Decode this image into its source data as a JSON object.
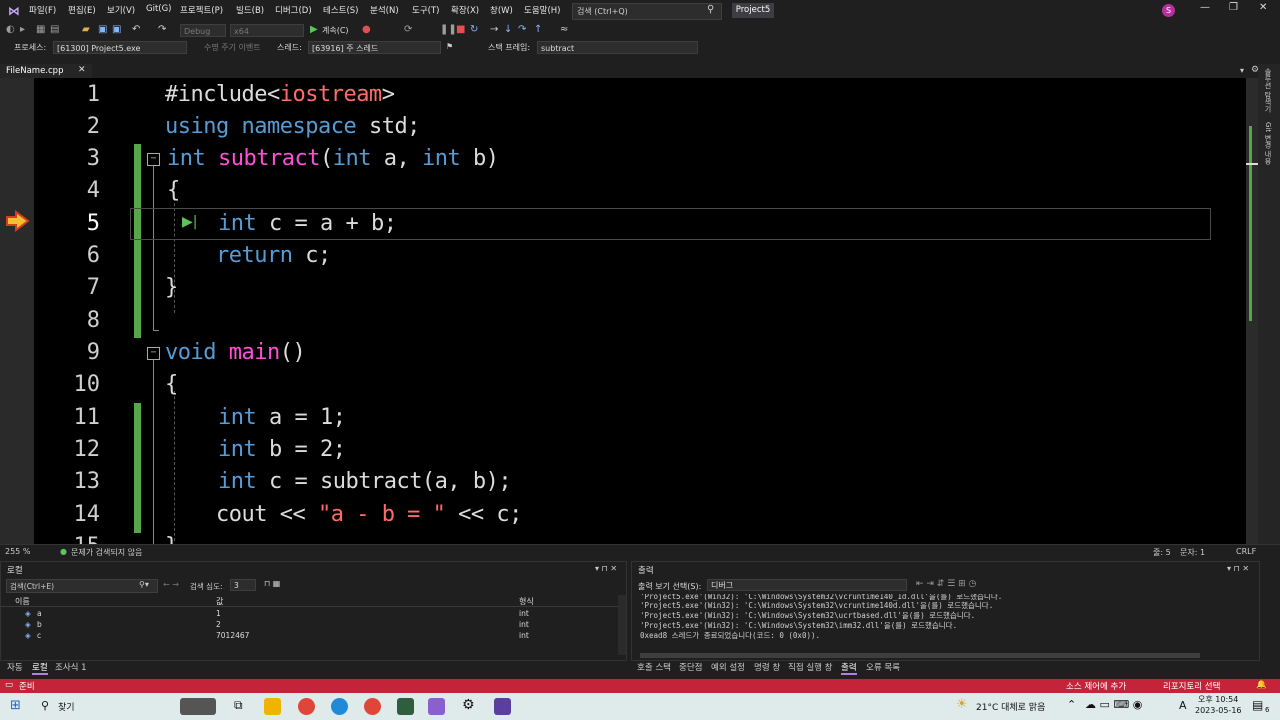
{
  "menu": {
    "items": [
      "파일(F)",
      "편집(E)",
      "보기(V)",
      "Git(G)",
      "프로젝트(P)",
      "빌드(B)",
      "디버그(D)",
      "테스트(S)",
      "분석(N)",
      "도구(T)",
      "확장(X)",
      "창(W)",
      "도움말(H)"
    ],
    "search_placeholder": "검색 (Ctrl+Q)",
    "solution_name": "Project5",
    "avatar_letter": "S"
  },
  "toolbar": {
    "config": "Debug",
    "platform": "x64",
    "continue_label": "계속(C)"
  },
  "debugbar": {
    "process_label": "프로세스:",
    "process_value": "[61300] Project5.exe",
    "lifecycle_label": "수명 주기 이벤트",
    "thread_label": "스레드:",
    "thread_value": "[63916] 주 스레드",
    "stackframe_label": "스택 프레임:",
    "stackframe_value": "subtract"
  },
  "editor": {
    "tab_title": "FileName.cpp",
    "current_line": 5,
    "line_numbers": [
      "1",
      "2",
      "3",
      "4",
      "5",
      "6",
      "7",
      "8",
      "9",
      "10",
      "11",
      "12",
      "13",
      "14",
      "15"
    ],
    "zoom": "255 %",
    "issues": "문제가 검색되지 않음",
    "position_line": "줄: 5",
    "position_char": "문자: 1",
    "line_ending": "CRLF",
    "right_panel_labels": [
      "솔루션 탐색기",
      "Git 변경 내용"
    ]
  },
  "code_tokens": {
    "l1_a": "#include<",
    "l1_b": "iostream",
    "l1_c": ">",
    "using": "using",
    "namespace": "namespace",
    "std": " std;",
    "int": "int",
    "subtract": "subtract",
    "paren_open": "(",
    "a_comma": " a, ",
    "b_close": " b)",
    "brace_open": "{",
    "brace_close": "}",
    "c_eq_ab": " c = a + b;",
    "return_kw": "return",
    "c_semi": " c;",
    "void": "void",
    "main": "main",
    "main_parens": "()",
    "a_eq_1": " a = 1;",
    "b_eq_2": " b = 2;",
    "c_eq_sub": " c = subtract(a, b);",
    "cout": "cout << ",
    "str": "\"a - b = \"",
    "cout_end": " << c;"
  },
  "locals": {
    "title": "로컬",
    "search_placeholder": "검색(Ctrl+E)",
    "search_depth_label": "검색 심도:",
    "search_depth": "3",
    "headers": [
      "이름",
      "값",
      "형식"
    ],
    "rows": [
      {
        "name": "a",
        "value": "1",
        "type": "int"
      },
      {
        "name": "b",
        "value": "2",
        "type": "int"
      },
      {
        "name": "c",
        "value": "7012467",
        "type": "int"
      }
    ],
    "tabs": [
      "자동",
      "로컬",
      "조사식 1"
    ]
  },
  "output": {
    "title": "출력",
    "show_label": "출력 보기 선택(S):",
    "show_value": "디버그",
    "lines": [
      "'Project5.exe'(Win32): 'C:\\Windows\\System32\\vcruntime140_1d.dll'을(를) 로드했습니다.",
      "'Project5.exe'(Win32): 'C:\\Windows\\System32\\vcruntime140d.dll'을(를) 로드했습니다.",
      "'Project5.exe'(Win32): 'C:\\Windows\\System32\\ucrtbased.dll'을(를) 로드했습니다.",
      "'Project5.exe'(Win32): 'C:\\Windows\\System32\\imm32.dll'을(를) 로드했습니다.",
      "0xead8 스레드가 종료되었습니다(코드: 0 (0x0))."
    ],
    "tabs": [
      "호출 스택",
      "중단점",
      "예외 설정",
      "명령 창",
      "직접 실행 창",
      "출력",
      "오류 목록"
    ]
  },
  "status": {
    "ready": "준비",
    "source_control": "소스 제어에 추가",
    "repo": "리포지토리 선택"
  },
  "taskbar": {
    "search": "찾기",
    "weather": "21°C  대체로 맑음",
    "ampm_time": "오후 10:54",
    "date": "2023-05-16",
    "lang": "A",
    "notif_count": "6"
  },
  "colors": {
    "keyword": "#569cd6",
    "function": "#ff4fd8",
    "string": "#ff6b6b",
    "change_bar": "#57a64a",
    "status_bar": "#c4233a",
    "accent": "#b07fe8"
  }
}
